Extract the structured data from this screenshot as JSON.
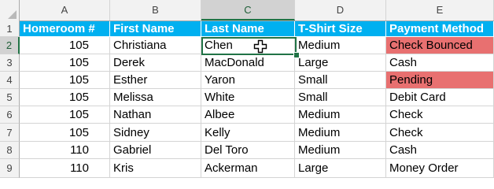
{
  "columns": [
    "A",
    "B",
    "C",
    "D",
    "E"
  ],
  "rows": [
    "1",
    "2",
    "3",
    "4",
    "5",
    "6",
    "7",
    "8",
    "9"
  ],
  "table": {
    "headers": [
      "Homeroom #",
      "First Name",
      "Last Name",
      "T-Shirt Size",
      "Payment Method"
    ],
    "data": [
      [
        "105",
        "Christiana",
        "Chen",
        "Medium",
        "Check Bounced"
      ],
      [
        "105",
        "Derek",
        "MacDonald",
        "Large",
        "Cash"
      ],
      [
        "105",
        "Esther",
        "Yaron",
        "Small",
        "Pending"
      ],
      [
        "105",
        "Melissa",
        "White",
        "Small",
        "Debit Card"
      ],
      [
        "105",
        "Nathan",
        "Albee",
        "Medium",
        "Check"
      ],
      [
        "105",
        "Sidney",
        "Kelly",
        "Medium",
        "Check"
      ],
      [
        "110",
        "Gabriel",
        "Del Toro",
        "Medium",
        "Cash"
      ],
      [
        "110",
        "Kris",
        "Ackerman",
        "Large",
        "Money Order"
      ]
    ]
  },
  "selection": {
    "cell": "C2",
    "column": "C",
    "row": "2"
  },
  "colors": {
    "header_fill": "#00b0f0",
    "header_text": "#ffffff",
    "highlight_fill": "#e87070",
    "selection_border": "#217346"
  },
  "highlighted_cells": [
    "E2",
    "E4"
  ],
  "cursor_icon": "excel-cross-cursor-icon"
}
